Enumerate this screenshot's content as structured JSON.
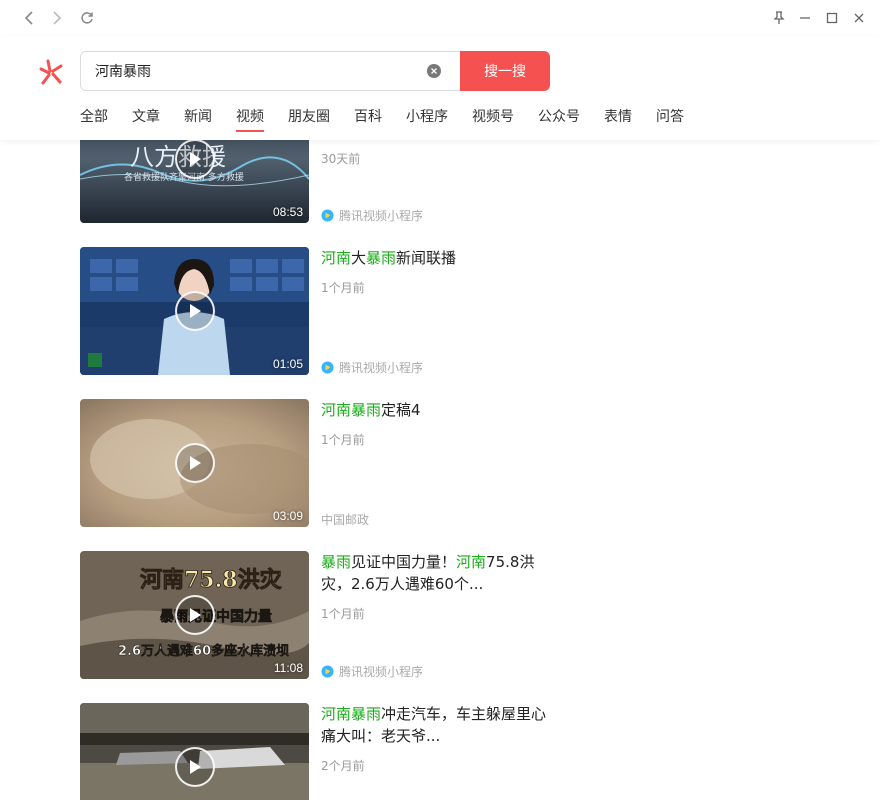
{
  "search": {
    "query": "河南暴雨",
    "button_label": "搜一搜"
  },
  "tabs": [
    "全部",
    "文章",
    "新闻",
    "视频",
    "朋友圈",
    "百科",
    "小程序",
    "视频号",
    "公众号",
    "表情",
    "问答"
  ],
  "active_tab": "视频",
  "results": [
    {
      "title_parts": [],
      "overlay_text": "八方救援",
      "overlay_sub": "各省救援队齐聚河南 多方救援",
      "time": "30天前",
      "duration": "08:53",
      "source": "腾讯视频小程序"
    },
    {
      "title_parts": [
        {
          "text": "河南",
          "hl": true
        },
        {
          "text": "大",
          "hl": false
        },
        {
          "text": "暴雨",
          "hl": true
        },
        {
          "text": "新闻联播",
          "hl": false
        }
      ],
      "time": "1个月前",
      "duration": "01:05",
      "source": "腾讯视频小程序"
    },
    {
      "title_parts": [
        {
          "text": "河南暴雨",
          "hl": true
        },
        {
          "text": "定稿4",
          "hl": false
        }
      ],
      "time": "1个月前",
      "duration": "03:09",
      "source": "中国邮政"
    },
    {
      "title_parts": [
        {
          "text": "暴雨",
          "hl": true
        },
        {
          "text": "见证中国力量！",
          "hl": false
        },
        {
          "text": "河南",
          "hl": true
        },
        {
          "text": "75.8洪灾，2.6万人遇难60个...",
          "hl": false
        }
      ],
      "overlay_text": "河南75.8洪灾",
      "overlay_mid": "暴雨见证中国力量",
      "overlay_sub": "2.6万人遇难60多座水库溃坝",
      "time": "1个月前",
      "duration": "11:08",
      "source": "腾讯视频小程序"
    },
    {
      "title_parts": [
        {
          "text": "河南暴雨",
          "hl": true
        },
        {
          "text": "冲走汽车，车主躲屋里心痛大叫：老天爷...",
          "hl": false
        }
      ],
      "time": "2个月前",
      "duration": "",
      "source": ""
    }
  ],
  "colors": {
    "accent": "#f55151",
    "highlight": "#1aad19"
  }
}
